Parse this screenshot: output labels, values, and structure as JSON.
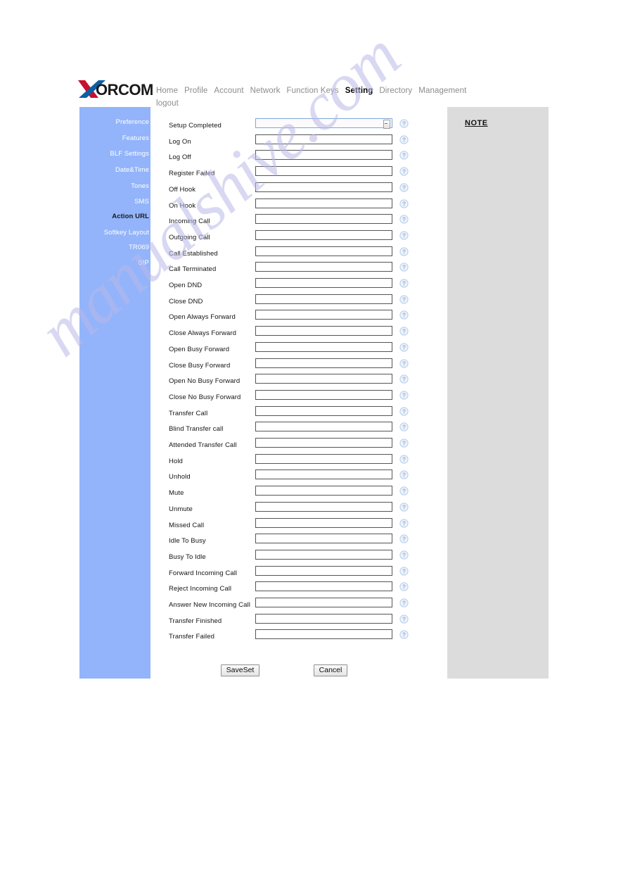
{
  "brand": {
    "logo_text": "XORCOM",
    "logo_x_color_left": "#c8102e",
    "logo_x_color_right": "#0b5fa5",
    "logo_word_color": "#1a1a1a"
  },
  "watermark": {
    "text": "manualshive.com",
    "color": "#b9b9e8"
  },
  "nav": {
    "items": [
      {
        "label": "Home",
        "active": false
      },
      {
        "label": "Profile",
        "active": false
      },
      {
        "label": "Account",
        "active": false
      },
      {
        "label": "Network",
        "active": false
      },
      {
        "label": "Function Keys",
        "active": false
      },
      {
        "label": "Setting",
        "active": true
      },
      {
        "label": "Directory",
        "active": false
      },
      {
        "label": "Management",
        "active": false
      }
    ],
    "logout": "logout"
  },
  "sidebar": {
    "background": "#93b4fa",
    "items": [
      {
        "label": "Preference",
        "active": false
      },
      {
        "label": "Features",
        "active": false
      },
      {
        "label": "BLF Settings",
        "active": false
      },
      {
        "label": "Date&Time",
        "active": false
      },
      {
        "label": "Tones",
        "active": false
      },
      {
        "label": "SMS",
        "active": false
      },
      {
        "label": "Action URL",
        "active": true
      },
      {
        "label": "Softkey Layout",
        "active": false
      },
      {
        "label": "TR069",
        "active": false
      },
      {
        "label": "SIP",
        "active": false
      }
    ]
  },
  "form": {
    "rows": [
      {
        "label": "Setup Completed",
        "value": "",
        "focused": true,
        "spinner": true
      },
      {
        "label": "Log On",
        "value": "",
        "focused": false,
        "spinner": false
      },
      {
        "label": "Log Off",
        "value": "",
        "focused": false,
        "spinner": false
      },
      {
        "label": "Register Failed",
        "value": "",
        "focused": false,
        "spinner": false
      },
      {
        "label": "Off Hook",
        "value": "",
        "focused": false,
        "spinner": false
      },
      {
        "label": "On Hook",
        "value": "",
        "focused": false,
        "spinner": false
      },
      {
        "label": "Incoming Call",
        "value": "",
        "focused": false,
        "spinner": false
      },
      {
        "label": "Outgoing Call",
        "value": "",
        "focused": false,
        "spinner": false
      },
      {
        "label": "Call Established",
        "value": "",
        "focused": false,
        "spinner": false
      },
      {
        "label": "Call Terminated",
        "value": "",
        "focused": false,
        "spinner": false
      },
      {
        "label": "Open DND",
        "value": "",
        "focused": false,
        "spinner": false
      },
      {
        "label": "Close DND",
        "value": "",
        "focused": false,
        "spinner": false
      },
      {
        "label": "Open Always Forward",
        "value": "",
        "focused": false,
        "spinner": false
      },
      {
        "label": "Close Always Forward",
        "value": "",
        "focused": false,
        "spinner": false
      },
      {
        "label": "Open Busy Forward",
        "value": "",
        "focused": false,
        "spinner": false
      },
      {
        "label": "Close Busy Forward",
        "value": "",
        "focused": false,
        "spinner": false
      },
      {
        "label": "Open No Busy Forward",
        "value": "",
        "focused": false,
        "spinner": false
      },
      {
        "label": "Close No Busy Forward",
        "value": "",
        "focused": false,
        "spinner": false
      },
      {
        "label": "Transfer Call",
        "value": "",
        "focused": false,
        "spinner": false
      },
      {
        "label": "Blind Transfer call",
        "value": "",
        "focused": false,
        "spinner": false
      },
      {
        "label": "Attended Transfer Call",
        "value": "",
        "focused": false,
        "spinner": false
      },
      {
        "label": "Hold",
        "value": "",
        "focused": false,
        "spinner": false
      },
      {
        "label": "Unhold",
        "value": "",
        "focused": false,
        "spinner": false
      },
      {
        "label": "Mute",
        "value": "",
        "focused": false,
        "spinner": false
      },
      {
        "label": "Unmute",
        "value": "",
        "focused": false,
        "spinner": false
      },
      {
        "label": "Missed Call",
        "value": "",
        "focused": false,
        "spinner": false
      },
      {
        "label": "Idle To Busy",
        "value": "",
        "focused": false,
        "spinner": false
      },
      {
        "label": "Busy To Idle",
        "value": "",
        "focused": false,
        "spinner": false
      },
      {
        "label": "Forward Incoming Call",
        "value": "",
        "focused": false,
        "spinner": false
      },
      {
        "label": "Reject Incoming Call",
        "value": "",
        "focused": false,
        "spinner": false
      },
      {
        "label": "Answer New Incoming Call",
        "value": "",
        "focused": false,
        "spinner": false
      },
      {
        "label": "Transfer Finished",
        "value": "",
        "focused": false,
        "spinner": false
      },
      {
        "label": "Transfer Failed",
        "value": "",
        "focused": false,
        "spinner": false
      }
    ],
    "help_icon": "help-question-icon"
  },
  "buttons": {
    "save": "SaveSet",
    "cancel": "Cancel"
  },
  "note": {
    "title": "NOTE",
    "background": "#dcdcdc"
  }
}
